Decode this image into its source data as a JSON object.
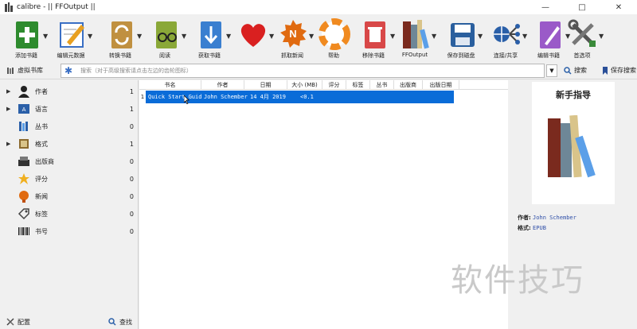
{
  "window": {
    "title": "calibre - || FFOutput ||",
    "minimize": "—",
    "maximize": "□",
    "close": "✕"
  },
  "toolbar": [
    {
      "label": "添加书籍",
      "icon": "add-book-icon",
      "color": "#2e8b2e"
    },
    {
      "label": "编辑元数据",
      "icon": "edit-metadata-icon",
      "color": "#3a6fc4"
    },
    {
      "label": "转换书籍",
      "icon": "convert-book-icon",
      "color": "#8b6a2e"
    },
    {
      "label": "阅读",
      "icon": "read-book-icon",
      "color": "#6a8a2e"
    },
    {
      "label": "获取书籍",
      "icon": "get-books-icon",
      "color": "#3a7fd0"
    },
    {
      "label": "",
      "icon": "heart-icon",
      "color": "#d92020"
    },
    {
      "label": "抓取新闻",
      "icon": "fetch-news-icon",
      "color": "#e06a10"
    },
    {
      "label": "帮助",
      "icon": "help-icon",
      "color": "#f08a20"
    },
    {
      "label": "移除书籍",
      "icon": "remove-book-icon",
      "color": "#d03030"
    },
    {
      "label": "FFOutput",
      "icon": "library-icon",
      "color": "#8b2e2e"
    },
    {
      "label": "保存到磁盘",
      "icon": "save-disk-icon",
      "color": "#3a7fd0"
    },
    {
      "label": "连接/共享",
      "icon": "connect-share-icon",
      "color": "#2a5fa8"
    },
    {
      "label": "编辑书籍",
      "icon": "edit-book-icon",
      "color": "#7a3aa8"
    },
    {
      "label": "首选项",
      "icon": "preferences-icon",
      "color": "#3a3a3a"
    }
  ],
  "virtual_library": {
    "label": "虚拟书库"
  },
  "search": {
    "placeholder": "搜索（对于高级搜索请点击左边的齿轮图标）",
    "search_label": "搜索",
    "saved_search_label": "保存搜索"
  },
  "sidebar": {
    "categories": [
      {
        "name": "作者",
        "count": "1",
        "icon": "authors-icon",
        "expandable": true
      },
      {
        "name": "语言",
        "count": "1",
        "icon": "languages-icon",
        "expandable": true
      },
      {
        "name": "丛书",
        "count": "0",
        "icon": "series-icon",
        "expandable": false
      },
      {
        "name": "格式",
        "count": "1",
        "icon": "formats-icon",
        "expandable": true
      },
      {
        "name": "出版商",
        "count": "0",
        "icon": "publisher-icon",
        "expandable": false
      },
      {
        "name": "评分",
        "count": "0",
        "icon": "rating-icon",
        "expandable": false
      },
      {
        "name": "新闻",
        "count": "0",
        "icon": "news-icon",
        "expandable": false
      },
      {
        "name": "标签",
        "count": "0",
        "icon": "tags-icon",
        "expandable": false
      },
      {
        "name": "书号",
        "count": "0",
        "icon": "identifiers-icon",
        "expandable": false
      }
    ],
    "configure_label": "配置",
    "find_label": "查找"
  },
  "table": {
    "columns": [
      "书名",
      "作者",
      "日期",
      "大小 (MB)",
      "评分",
      "标签",
      "丛书",
      "出版商",
      "出版日期"
    ],
    "rows": [
      {
        "num": "1",
        "title": "Quick Start Guide",
        "author": "John Schember",
        "date": "14 4月 2019",
        "size": "<0.1"
      }
    ]
  },
  "detail": {
    "cover_title": "新手指导",
    "author_label": "作者:",
    "author_value": "John Schember",
    "format_label": "格式:",
    "format_value": "EPUB"
  },
  "watermark": "软件技巧"
}
